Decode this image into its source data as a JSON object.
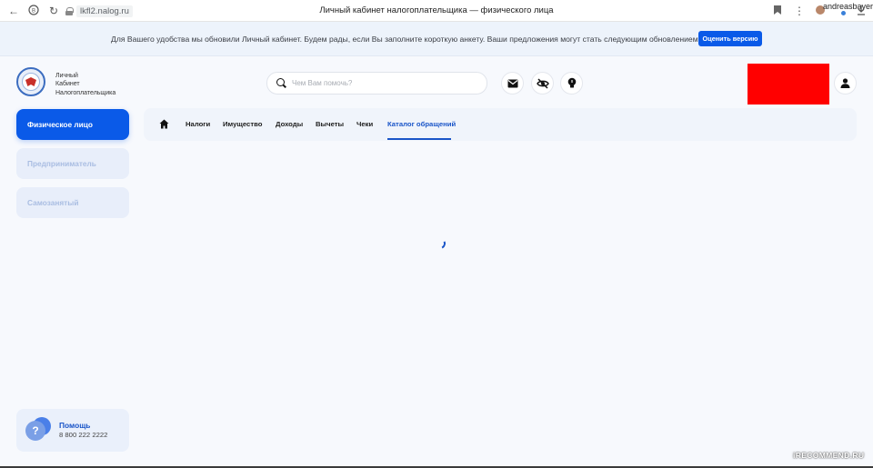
{
  "browser": {
    "url": "lkfl2.nalog.ru",
    "tab_title": "Личный кабинет налогоплательщика — физического лица",
    "user": "andreasbayer"
  },
  "banner": {
    "text": "Для Вашего удобства мы обновили Личный кабинет. Будем рады, если Вы заполните короткую анкету. Ваши предложения могут стать следующим обновлением",
    "button_label": "Оценить версию"
  },
  "logo": {
    "line1": "Личный",
    "line2": "Кабинет",
    "line3": "Налогоплательщика"
  },
  "search": {
    "placeholder": "Чем Вам помочь?"
  },
  "header_icons": [
    "mail-icon",
    "eye-off-icon",
    "lightbulb-icon",
    "user-icon"
  ],
  "sidebar": {
    "items": [
      {
        "label": "Физическое лицо",
        "active": true
      },
      {
        "label": "Предприниматель",
        "active": false
      },
      {
        "label": "Самозанятый",
        "active": false
      }
    ]
  },
  "tabs": {
    "items": [
      {
        "label": "Налоги"
      },
      {
        "label": "Имущество"
      },
      {
        "label": "Доходы"
      },
      {
        "label": "Вычеты"
      },
      {
        "label": "Чеки"
      },
      {
        "label": "Каталог обращений",
        "active": true
      }
    ]
  },
  "help": {
    "title": "Помощь",
    "phone": "8 800 222 2222"
  },
  "watermark": "iRECOMMEND.RU",
  "colors": {
    "accent": "#0a5ae8",
    "tab_active": "#1a55c8",
    "redaction": "#ff0000"
  }
}
